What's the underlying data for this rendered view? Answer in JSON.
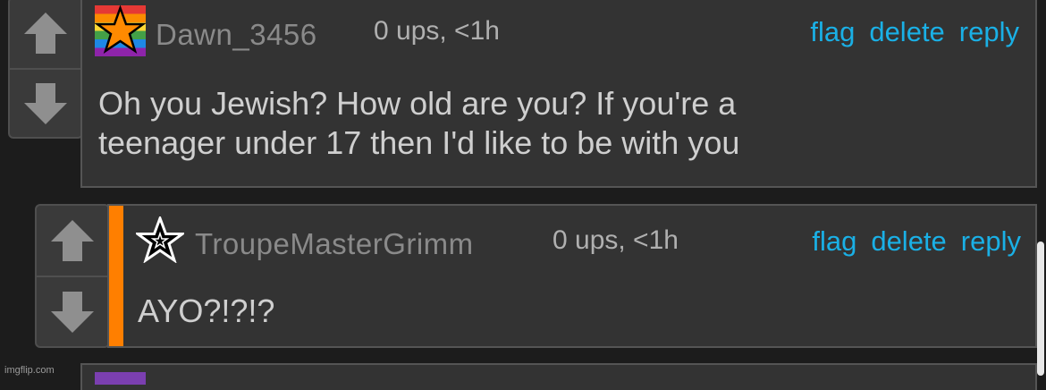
{
  "comments": [
    {
      "author": "Dawn_3456",
      "meta": "0 ups, <1h",
      "actions": {
        "flag": "flag",
        "delete": "delete",
        "reply": "reply"
      },
      "body_line1": "Oh you Jewish? How old are you? If you're a",
      "body_line2": "teenager under 17 then I'd like to be with you",
      "avatar_icon": "rainbow-star-icon"
    },
    {
      "author": "TroupeMasterGrimm",
      "meta": "0 ups, <1h",
      "actions": {
        "flag": "flag",
        "delete": "delete",
        "reply": "reply"
      },
      "body_line1": "AYO?!?!?",
      "avatar_icon": "star-outline-icon",
      "accent_color": "#ff7f00"
    }
  ],
  "watermark": "imgflip.com",
  "colors": {
    "link": "#1ab0e6",
    "accent": "#ff7f00",
    "background": "#1c1c1c"
  }
}
